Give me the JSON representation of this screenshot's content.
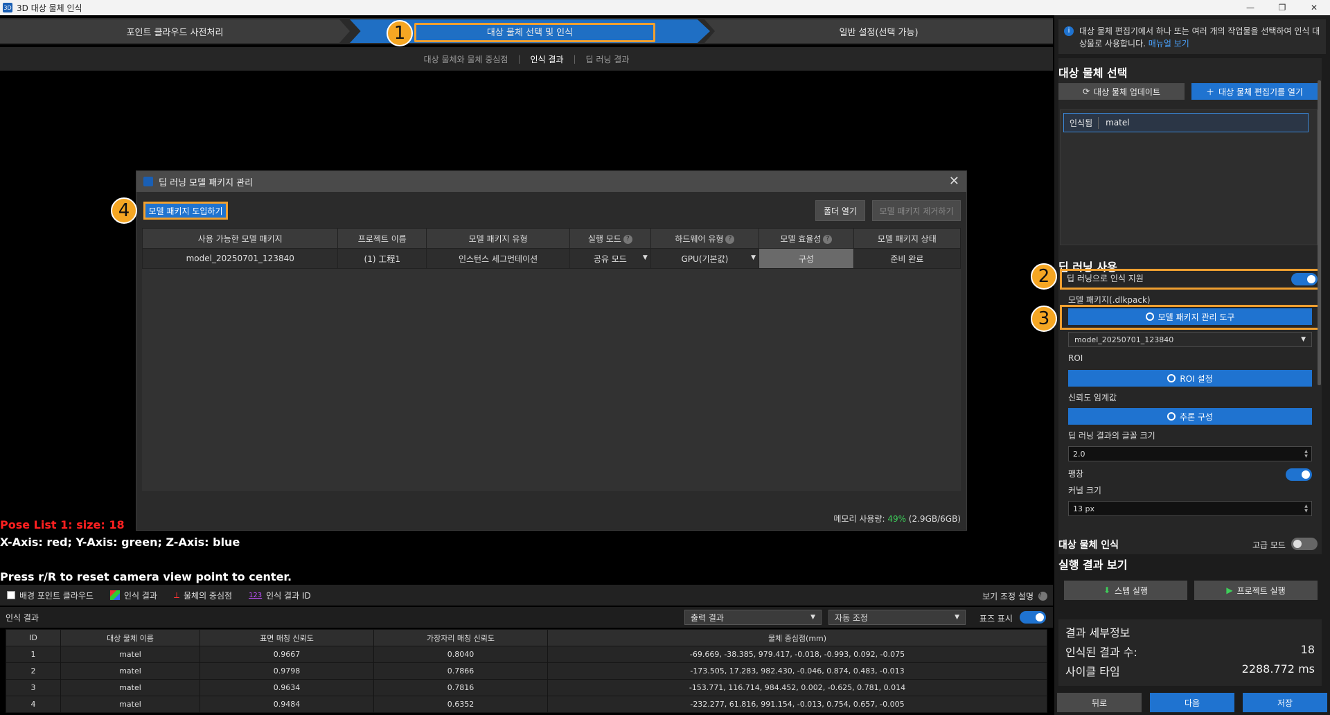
{
  "window": {
    "title": "3D 대상 물체 인식",
    "minimize": "—",
    "maximize": "❐",
    "close": "✕",
    "app_icon": "3D"
  },
  "steps": {
    "step1": "포인트 클라우드 사전처리",
    "step2": "대상 물체 선택 및 인식",
    "step3": "일반 설정(선택 가능)"
  },
  "badges": {
    "b1": "1",
    "b2": "2",
    "b3": "3",
    "b4": "4"
  },
  "subtabs": {
    "t1": "대상 물체와 물체 중심점",
    "t2": "인식 결과",
    "t3": "딥 러닝 결과",
    "sep": "|"
  },
  "viewer": {
    "pose": "Pose List 1: size: 18",
    "axes": "X-Axis: red; Y-Axis: green; Z-Axis: blue",
    "reset": "Press r/R to reset camera view point to center."
  },
  "modal": {
    "title": "딥 러닝 모델 패키지 관리",
    "close": "✕",
    "import_btn": "모델 패키지 도입하기",
    "folder_btn": "폴더 열기",
    "remove_btn": "모델 패키지 제거하기",
    "columns": [
      "사용 가능한 모델 패키지",
      "프로젝트 이름",
      "모델 패키지 유형",
      "실행 모드",
      "하드웨어 유형",
      "모델 효율성",
      "모델 패키지 상태"
    ],
    "row": {
      "package": "model_20250701_123840",
      "project": "(1) 工程1",
      "type": "인스턴스 세그먼테이션",
      "mode": "공유 모드",
      "hardware": "GPU(기본값)",
      "efficiency": "구성",
      "status": "준비 완료"
    },
    "help": "?",
    "memory_label": "메모리 사용량: ",
    "memory_pct": "49%",
    "memory_detail": " (2.9GB/6GB)"
  },
  "toolbar": {
    "bg_points": "배경 포인트 클라우드",
    "results": "인식 결과",
    "centers": "물체의 중심점",
    "ids_icon": "123",
    "ids": "인식 결과 ID",
    "view_help": "보기 조정 설명",
    "help": "?"
  },
  "results_bar": {
    "label": "인식 결과",
    "output": "출력 결과",
    "auto": "자동 조정",
    "table_show": "표즈 표시"
  },
  "results_table": {
    "columns": [
      "ID",
      "대상 물체 이름",
      "표면 매칭 신뢰도",
      "가장자리 매칭 신뢰도",
      "물체 중심점(mm)"
    ],
    "rows": [
      [
        "1",
        "matel",
        "0.9667",
        "0.8040",
        "-69.669, -38.385, 979.417, -0.018, -0.993, 0.092, -0.075"
      ],
      [
        "2",
        "matel",
        "0.9798",
        "0.7866",
        "-173.505, 17.283, 982.430, -0.046, 0.874, 0.483, -0.013"
      ],
      [
        "3",
        "matel",
        "0.9634",
        "0.7816",
        "-153.771, 116.714, 984.452, 0.002, -0.625, 0.781, 0.014"
      ],
      [
        "4",
        "matel",
        "0.9484",
        "0.6352",
        "-232.277, 61.816, 991.154, -0.013, 0.754, 0.657, -0.005"
      ]
    ]
  },
  "right": {
    "info_icon": "i",
    "info": "대상 물체 편집기에서 하나 또는 여러 개의 작업물을 선택하여 인식 대상물로 사용합니다.",
    "info_link": "매뉴얼 보기",
    "sel_title": "대상 물체 선택",
    "update_btn": "대상 물체 업데이트",
    "update_icon": "⟳",
    "open_editor_btn": "대상 물체 편집기를 열기",
    "plus_icon": "＋",
    "item_recognized": "인식됨",
    "item_name": "matel",
    "dl_title": "딥 러닝 사용",
    "dl_assist": "딥 러닝으로 인식 지원",
    "model_pkg": "모델 패키지(.dlkpack)",
    "pkg_tool_btn": "모델 패키지 관리 도구",
    "model_select": "model_20250701_123840",
    "roi": "ROI",
    "roi_btn": "ROI 설정",
    "conf": "신뢰도 임계값",
    "infer_btn": "추론 구성",
    "font_size": "딥 러닝 결과의 글꼴 크기",
    "font_size_val": "2.0",
    "dilate": "팽창",
    "kernel": "커널 크기",
    "kernel_val": "13 px",
    "recog_title": "대상 물체 인식",
    "advanced": "고급 모드",
    "run_title": "실행 결과 보기",
    "step_run": "스텝 실행",
    "proj_run": "프로젝트 실행",
    "detail_title": "결과 세부정보",
    "count_label": "인식된 결과 수:",
    "count_val": "18",
    "cycle_label": "사이클 타임",
    "cycle_val": "2288.772 ms",
    "back": "뒤로",
    "next": "다음",
    "save": "저장"
  }
}
